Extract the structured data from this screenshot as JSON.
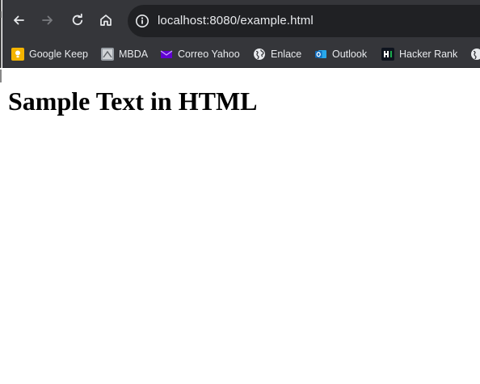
{
  "toolbar": {
    "back_icon": "arrow-left-icon",
    "forward_icon": "arrow-right-icon",
    "reload_icon": "reload-icon",
    "home_icon": "home-icon",
    "site_info_icon": "info-icon",
    "url": "localhost:8080/example.html"
  },
  "bookmarks": {
    "items": [
      {
        "label": "Google Keep",
        "icon": "google-keep-icon",
        "color": "#f4b400"
      },
      {
        "label": "MBDA",
        "icon": "mbda-icon",
        "color": "#9aa0a6"
      },
      {
        "label": "Correo Yahoo",
        "icon": "yahoo-mail-icon",
        "color": "#6001d2"
      },
      {
        "label": "Enlace",
        "icon": "globe-icon",
        "color": "#e8eaed"
      },
      {
        "label": "Outlook",
        "icon": "outlook-icon",
        "color": "#0f6cbd"
      },
      {
        "label": "Hacker Rank",
        "icon": "hackerrank-icon",
        "color": "#1ba94c"
      }
    ],
    "overflow_icon": "globe-icon"
  },
  "page": {
    "heading": "Sample Text in HTML"
  },
  "colors": {
    "chrome_background": "#35363a",
    "omnibox_background": "#202124",
    "chrome_text": "#e8eaed",
    "page_background": "#ffffff"
  }
}
